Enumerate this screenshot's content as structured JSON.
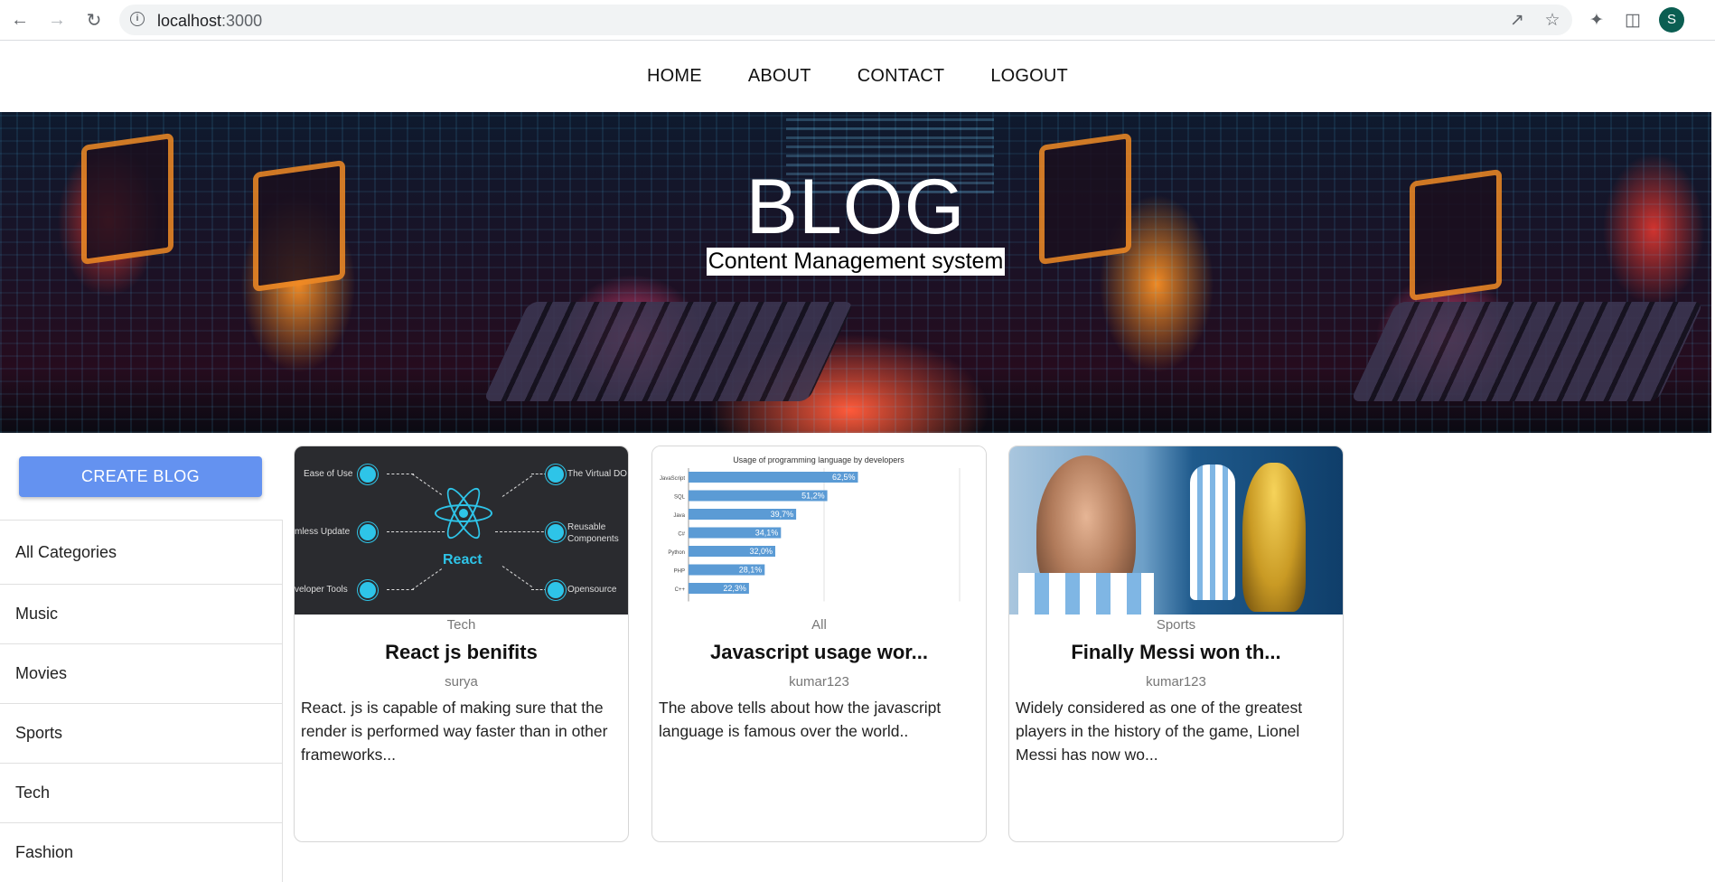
{
  "browser": {
    "url_host": "localhost",
    "url_port": ":3000",
    "profile_initial": "S",
    "icons": [
      "back-icon",
      "forward-icon",
      "reload-icon",
      "site-info-icon",
      "share-icon",
      "bookmark-star-icon",
      "extensions-icon",
      "side-panel-icon"
    ]
  },
  "nav": {
    "links": [
      "HOME",
      "ABOUT",
      "CONTACT",
      "LOGOUT"
    ]
  },
  "banner": {
    "title": "BLOG",
    "subtitle": "Content Management system"
  },
  "sidebar": {
    "create_label": "CREATE BLOG",
    "categories": [
      "All Categories",
      "Music",
      "Movies",
      "Sports",
      "Tech",
      "Fashion"
    ]
  },
  "posts": [
    {
      "category": "Tech",
      "title": "React js benifits",
      "author": "surya",
      "description": "React. js is capable of making sure that the render is performed way faster than in other frameworks...",
      "image": {
        "center_label": "React",
        "left_items": [
          "Ease of Use",
          "mless Update",
          "veloper Tools"
        ],
        "right_items": [
          "The Virtual DO",
          "Reusable Components",
          "Opensource"
        ]
      }
    },
    {
      "category": "All",
      "title": "Javascript usage wor...",
      "author": "kumar123",
      "description": "The above tells about how the javascript language is famous over the world..",
      "image": {
        "chart_data": {
          "type": "bar",
          "title": "Usage of programming language by developers",
          "categories": [
            "JavaScript",
            "SQL",
            "Java",
            "C#",
            "Python",
            "PHP",
            "C++"
          ],
          "values": [
            62.5,
            51.2,
            39.7,
            34.1,
            32.0,
            28.1,
            22.3
          ],
          "value_labels": [
            "62,5%",
            "51,2%",
            "39,7%",
            "34,1%",
            "32,0%",
            "28,1%",
            "22,3%"
          ],
          "bar_color": "#5b9bd5",
          "orientation": "horizontal",
          "xlim": [
            0,
            100
          ]
        }
      }
    },
    {
      "category": "Sports",
      "title": "Finally Messi won th...",
      "author": "kumar123",
      "description": "Widely considered as one of the greatest players in the history of the game, Lionel Messi has now wo..."
    }
  ],
  "colors": {
    "accent": "#6492f0",
    "react_blue": "#2ec4e8"
  }
}
